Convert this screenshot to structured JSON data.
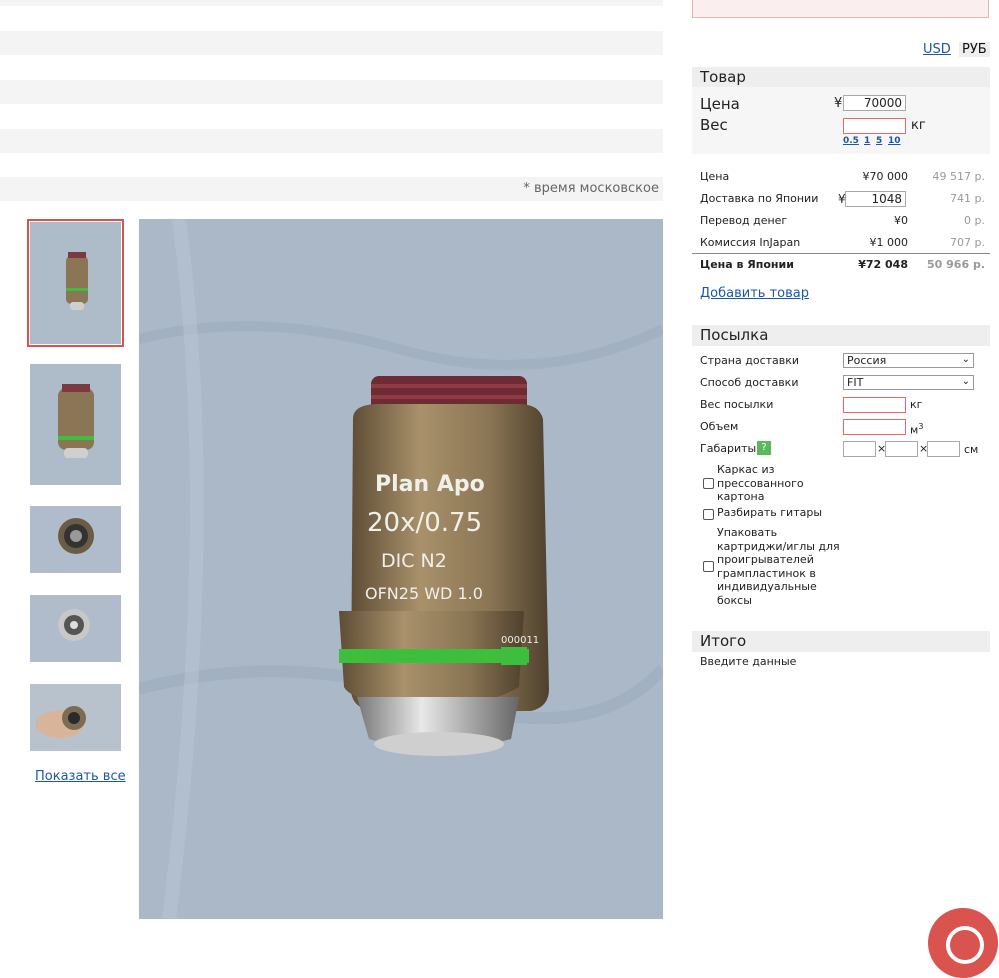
{
  "timezone_note": "* время московское",
  "show_all_label": "Показать все",
  "currency": {
    "usd": "USD",
    "rub": "РУБ"
  },
  "product_section": {
    "title": "Товар",
    "price_label": "Цена",
    "price_value": "70000",
    "weight_label": "Вес",
    "weight_unit": "кг",
    "weight_quick": [
      "0.5",
      "1",
      "5",
      "10"
    ],
    "yen_sign": "¥"
  },
  "cost_rows": [
    {
      "label": "Цена",
      "yen": "",
      "value": "¥70 000",
      "rub": "49 517 р."
    },
    {
      "label": "Доставка по Японии",
      "yen": "¥",
      "value": "1048",
      "rub": "741 р."
    },
    {
      "label": "Перевод денег",
      "yen": "",
      "value": "¥0",
      "rub": "0 р."
    },
    {
      "label": "Комиссия InJapan",
      "yen": "",
      "value": "¥1 000",
      "rub": "707 р."
    },
    {
      "label": "Цена в Японии",
      "yen": "",
      "value": "¥72 048",
      "rub": "50 966 р."
    }
  ],
  "add_item_label": "Добавить товар",
  "parcel_section": {
    "title": "Посылка",
    "country_label": "Страна доставки",
    "country_value": "Россия",
    "method_label": "Способ доставки",
    "method_value": "FIT",
    "weight_label": "Вес посылки",
    "weight_unit": "кг",
    "volume_label": "Объем",
    "volume_unit": "м",
    "volume_unit_sup": "3",
    "dims_label": "Габариты",
    "dims_help": "?",
    "dims_sep": "×",
    "dims_unit": "см",
    "options": [
      "Каркас из прессованного картона",
      "Разбирать гитары",
      "Упаковать картриджи/иглы для проигрывателей грампластинок в индивидуальные боксы"
    ]
  },
  "summary_section": {
    "title": "Итого",
    "text": "Введите данные"
  },
  "lens_text": {
    "line1": "Plan Apo",
    "line2": "20x/0.75",
    "line3": "DIC N2",
    "line4": "OFN25  WD 1.0",
    "serial": "000011"
  },
  "colors": {
    "accent_link": "#1a57a6",
    "selected_thumb": "#d9534f",
    "lens_body": "#8a7554",
    "lens_band": "#3dbf3d",
    "cloth": "#aab8c8"
  }
}
